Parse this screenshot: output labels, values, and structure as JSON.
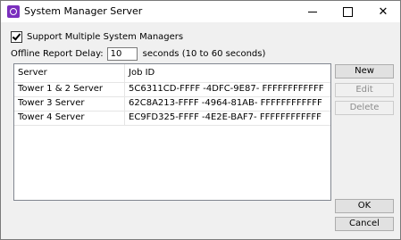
{
  "window": {
    "title": "System Manager Server",
    "controls": {
      "minimize": "minimize",
      "maximize": "maximize",
      "close": "✕"
    }
  },
  "options": {
    "support_multiple_label": "Support Multiple System Managers",
    "support_multiple_checked": true,
    "delay_label": "Offline Report Delay:",
    "delay_value": "10",
    "delay_hint": "seconds (10 to 60 seconds)"
  },
  "table": {
    "columns": [
      "Server",
      "Job ID"
    ],
    "rows": [
      {
        "server": "Tower 1 & 2 Server",
        "job_id": "5C6311CD-FFFF -4DFC-9E87- FFFFFFFFFFFF"
      },
      {
        "server": "Tower 3 Server",
        "job_id": "62C8A213-FFFF -4964-81AB- FFFFFFFFFFFF"
      },
      {
        "server": "Tower 4 Server",
        "job_id": "EC9FD325-FFFF -4E2E-BAF7- FFFFFFFFFFFF"
      }
    ]
  },
  "buttons": {
    "new": "New",
    "edit": "Edit",
    "delete": "Delete",
    "ok": "OK",
    "cancel": "Cancel"
  },
  "colors": {
    "app_icon": "#7b2fbe",
    "dialog_bg": "#f0f0f0"
  }
}
